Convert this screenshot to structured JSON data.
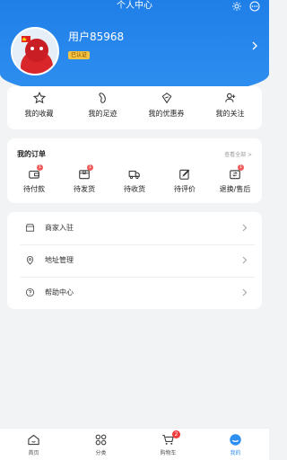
{
  "header": {
    "title": "个人中心",
    "username": "用户85968",
    "level": "已认证"
  },
  "quick_links": [
    {
      "label": "我的收藏",
      "icon": "star-icon"
    },
    {
      "label": "我的足迹",
      "icon": "footprint-icon"
    },
    {
      "label": "我的优惠券",
      "icon": "coupon-icon"
    },
    {
      "label": "我的关注",
      "icon": "follow-icon"
    }
  ],
  "orders": {
    "title": "我的订单",
    "view_all": "查看全部 >",
    "items": [
      {
        "label": "待付款",
        "badge": "1",
        "icon": "wallet-icon"
      },
      {
        "label": "待发货",
        "badge": "1",
        "icon": "package-icon"
      },
      {
        "label": "待收货",
        "badge": "",
        "icon": "truck-icon"
      },
      {
        "label": "待评价",
        "badge": "",
        "icon": "review-icon"
      },
      {
        "label": "退换/售后",
        "badge": "1",
        "icon": "refund-icon"
      }
    ]
  },
  "menu": [
    {
      "label": "商家入驻",
      "icon": "store-icon"
    },
    {
      "label": "地址管理",
      "icon": "location-icon"
    },
    {
      "label": "帮助中心",
      "icon": "help-icon"
    }
  ],
  "tabbar": {
    "items": [
      {
        "label": "首页",
        "icon": "home-icon"
      },
      {
        "label": "分类",
        "icon": "category-icon"
      },
      {
        "label": "购物车",
        "icon": "cart-icon"
      },
      {
        "label": "我的",
        "icon": "profile-icon"
      }
    ],
    "cart_count": "2",
    "active": "我的"
  },
  "colors": {
    "brand_blue": "#2f8ff0",
    "badge_red": "#f25a5a",
    "level_gold": "#f5c242"
  }
}
